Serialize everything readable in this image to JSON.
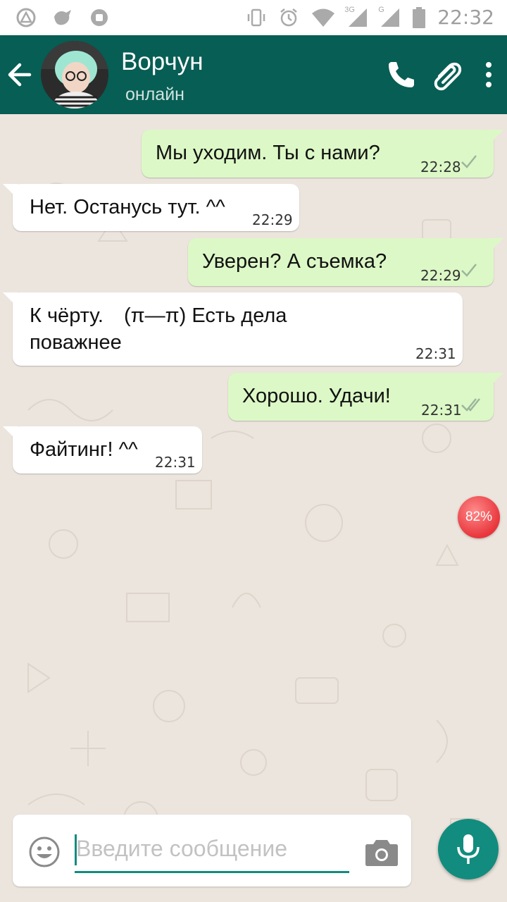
{
  "status_bar": {
    "time": "22:32",
    "network_labels": [
      "3G",
      "G"
    ]
  },
  "header": {
    "contact_name": "Ворчун",
    "status": "онлайн"
  },
  "messages": [
    {
      "direction": "out",
      "text": "Мы уходим. Ты с нами?",
      "time": "22:28",
      "ticks": "single"
    },
    {
      "direction": "in",
      "text": "Нет. Останусь тут. ^^",
      "time": "22:29"
    },
    {
      "direction": "out",
      "text": "Уверен? А съемка?",
      "time": "22:29",
      "ticks": "single"
    },
    {
      "direction": "in",
      "text_lines": [
        "К чёрту.　(π―π)  Есть дела",
        "поважнее"
      ],
      "time": "22:31"
    },
    {
      "direction": "out",
      "text": "Хорошо. Удачи!",
      "time": "22:31",
      "ticks": "double"
    },
    {
      "direction": "in",
      "text": "Файтинг! ^^",
      "time": "22:31"
    }
  ],
  "overlay_badge": "82%",
  "input": {
    "placeholder": "Введите сообщение"
  },
  "colors": {
    "app_bar": "#075e54",
    "outgoing_bubble": "#dcf8c6",
    "incoming_bubble": "#ffffff",
    "accent": "#128c7e",
    "chat_background": "#ece5dd"
  },
  "icons": [
    "back-arrow-icon",
    "call-icon",
    "attach-icon",
    "more-icon",
    "emoji-icon",
    "camera-icon",
    "mic-icon"
  ]
}
